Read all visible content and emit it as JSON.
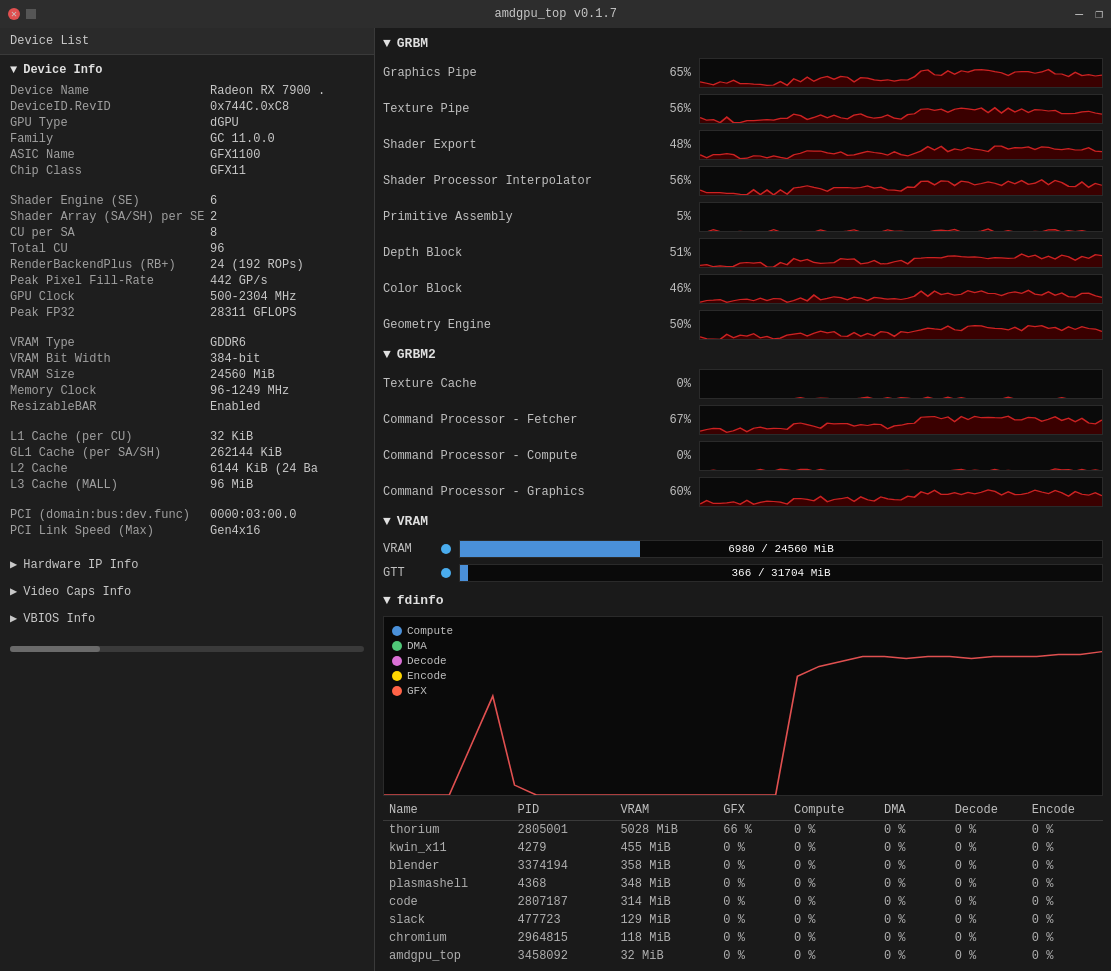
{
  "titlebar": {
    "title": "amdgpu_top v0.1.7",
    "minimize": "—",
    "restore": "❐",
    "close": "✕"
  },
  "sidebar": {
    "device_list_label": "Device List",
    "device_info_label": "Device Info",
    "device_info_arrow": "▼",
    "info": [
      {
        "label": "Device Name",
        "value": "Radeon RX 7900 ."
      },
      {
        "label": "DeviceID.RevID",
        "value": "0x744C.0xC8"
      },
      {
        "label": "GPU Type",
        "value": "dGPU"
      },
      {
        "label": "Family",
        "value": "GC 11.0.0"
      },
      {
        "label": "ASIC Name",
        "value": "GFX1100"
      },
      {
        "label": "Chip Class",
        "value": "GFX11"
      }
    ],
    "info2": [
      {
        "label": "Shader Engine (SE)",
        "value": "6"
      },
      {
        "label": "Shader Array (SA/SH) per SE",
        "value": "2"
      },
      {
        "label": "CU per SA",
        "value": "8"
      },
      {
        "label": "Total CU",
        "value": "96"
      },
      {
        "label": "RenderBackendPlus (RB+)",
        "value": "24 (192 ROPs)"
      },
      {
        "label": "Peak Pixel Fill-Rate",
        "value": "442 GP/s"
      },
      {
        "label": "GPU Clock",
        "value": "500-2304 MHz"
      },
      {
        "label": "Peak FP32",
        "value": "28311 GFLOPS"
      }
    ],
    "info3": [
      {
        "label": "VRAM Type",
        "value": "GDDR6"
      },
      {
        "label": "VRAM Bit Width",
        "value": "384-bit"
      },
      {
        "label": "VRAM Size",
        "value": "24560 MiB"
      },
      {
        "label": "Memory Clock",
        "value": "96-1249 MHz"
      },
      {
        "label": "ResizableBAR",
        "value": "Enabled"
      }
    ],
    "info4": [
      {
        "label": "L1 Cache (per CU)",
        "value": "32 KiB"
      },
      {
        "label": "GL1 Cache (per SA/SH)",
        "value": "262144 KiB"
      },
      {
        "label": "L2 Cache",
        "value": "6144 KiB (24 Ba"
      },
      {
        "label": "L3 Cache (MALL)",
        "value": "96 MiB"
      }
    ],
    "info5": [
      {
        "label": "PCI (domain:bus:dev.func)",
        "value": "0000:03:00.0"
      },
      {
        "label": "PCI Link Speed (Max)",
        "value": "Gen4x16"
      }
    ],
    "hardware_ip_label": "Hardware IP Info",
    "video_caps_label": "Video Caps Info",
    "vbios_label": "VBIOS Info"
  },
  "grbm": {
    "label": "GRBM",
    "metrics": [
      {
        "name": "Graphics Pipe",
        "pct": "65%",
        "fill": 65
      },
      {
        "name": "Texture Pipe",
        "pct": "56%",
        "fill": 56
      },
      {
        "name": "Shader Export",
        "pct": "48%",
        "fill": 48
      },
      {
        "name": "Shader Processor Interpolator",
        "pct": "56%",
        "fill": 56
      },
      {
        "name": "Primitive Assembly",
        "pct": "5%",
        "fill": 5
      },
      {
        "name": "Depth Block",
        "pct": "51%",
        "fill": 51
      },
      {
        "name": "Color Block",
        "pct": "46%",
        "fill": 46
      },
      {
        "name": "Geometry Engine",
        "pct": "50%",
        "fill": 50
      }
    ]
  },
  "grbm2": {
    "label": "GRBM2",
    "metrics": [
      {
        "name": "Texture Cache",
        "pct": "0%",
        "fill": 0
      },
      {
        "name": "Command Processor - Fetcher",
        "pct": "67%",
        "fill": 67
      },
      {
        "name": "Command Processor - Compute",
        "pct": "0%",
        "fill": 0
      },
      {
        "name": "Command Processor - Graphics",
        "pct": "60%",
        "fill": 60
      }
    ]
  },
  "vram": {
    "label": "VRAM",
    "vram_label": "VRAM",
    "gtt_label": "GTT",
    "vram_used": "6980",
    "vram_total": "24560",
    "vram_text": "6980 / 24560 MiB",
    "vram_pct": 28,
    "gtt_used": "366",
    "gtt_total": "31704",
    "gtt_text": "366 / 31704 MiB",
    "gtt_pct": 1.2,
    "vram_dot_color": "#4aaced",
    "gtt_dot_color": "#4aaced"
  },
  "fdinfo": {
    "label": "fdinfo",
    "legend": [
      {
        "name": "Compute",
        "color": "#4a90d9"
      },
      {
        "name": "DMA",
        "color": "#50c878"
      },
      {
        "name": "Decode",
        "color": "#da70d6"
      },
      {
        "name": "Encode",
        "color": "#ffd700"
      },
      {
        "name": "GFX",
        "color": "#ff6347"
      }
    ],
    "table_headers": [
      "Name",
      "PID",
      "VRAM",
      "GFX",
      "Compute",
      "DMA",
      "Decode",
      "Encode"
    ],
    "rows": [
      {
        "name": "thorium",
        "pid": "2805001",
        "vram": "5028 MiB",
        "gfx": "66 %",
        "compute": "0 %",
        "dma": "0 %",
        "decode": "0 %",
        "encode": "0 %"
      },
      {
        "name": "kwin_x11",
        "pid": "4279",
        "vram": "455 MiB",
        "gfx": "0 %",
        "compute": "0 %",
        "dma": "0 %",
        "decode": "0 %",
        "encode": "0 %"
      },
      {
        "name": "blender",
        "pid": "3374194",
        "vram": "358 MiB",
        "gfx": "0 %",
        "compute": "0 %",
        "dma": "0 %",
        "decode": "0 %",
        "encode": "0 %"
      },
      {
        "name": "plasmashell",
        "pid": "4368",
        "vram": "348 MiB",
        "gfx": "0 %",
        "compute": "0 %",
        "dma": "0 %",
        "decode": "0 %",
        "encode": "0 %"
      },
      {
        "name": "code",
        "pid": "2807187",
        "vram": "314 MiB",
        "gfx": "0 %",
        "compute": "0 %",
        "dma": "0 %",
        "decode": "0 %",
        "encode": "0 %"
      },
      {
        "name": "slack",
        "pid": "477723",
        "vram": "129 MiB",
        "gfx": "0 %",
        "compute": "0 %",
        "dma": "0 %",
        "decode": "0 %",
        "encode": "0 %"
      },
      {
        "name": "chromium",
        "pid": "2964815",
        "vram": "118 MiB",
        "gfx": "0 %",
        "compute": "0 %",
        "dma": "0 %",
        "decode": "0 %",
        "encode": "0 %"
      },
      {
        "name": "amdgpu_top",
        "pid": "3458092",
        "vram": "32 MiB",
        "gfx": "0 %",
        "compute": "0 %",
        "dma": "0 %",
        "decode": "0 %",
        "encode": "0 %"
      }
    ]
  }
}
